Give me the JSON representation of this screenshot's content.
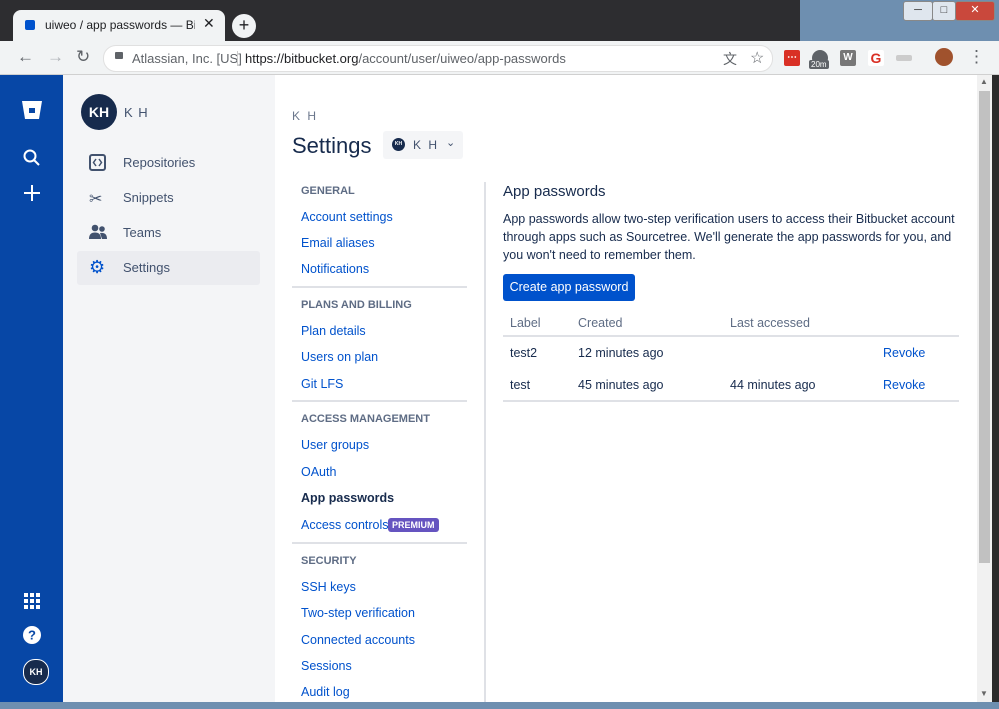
{
  "browser": {
    "tab_title": "uiweo / app passwords — Bitbuc",
    "tab_close": "✕",
    "new_tab": "+",
    "site_info": "Atlassian, Inc. [US]",
    "url_host": "https://bitbucket.org",
    "url_path": "/account/user/uiweo/app-passwords",
    "ext_badge": "20m",
    "window_min": "─",
    "window_max": "□",
    "window_close": "✕"
  },
  "global_nav": {
    "avatar": "KH"
  },
  "sidebar": {
    "avatar": "KH",
    "user_name": "K H",
    "items": [
      {
        "label": "Repositories",
        "icon": "repo-icon"
      },
      {
        "label": "Snippets",
        "icon": "scissors-icon"
      },
      {
        "label": "Teams",
        "icon": "people-icon"
      },
      {
        "label": "Settings",
        "icon": "gear-icon"
      }
    ]
  },
  "header": {
    "breadcrumb": "K H",
    "title": "Settings",
    "account_avatar": "KH",
    "account_label": "K H"
  },
  "settings_nav": {
    "general": "GENERAL",
    "account_settings": "Account settings",
    "email_aliases": "Email aliases",
    "notifications": "Notifications",
    "plans": "PLANS AND BILLING",
    "plan_details": "Plan details",
    "users_on_plan": "Users on plan",
    "git_lfs": "Git LFS",
    "access": "ACCESS MANAGEMENT",
    "user_groups": "User groups",
    "oauth": "OAuth",
    "app_passwords": "App passwords",
    "access_controls": "Access controls",
    "premium": "PREMIUM",
    "security": "SECURITY",
    "ssh_keys": "SSH keys",
    "two_step": "Two-step verification",
    "connected": "Connected accounts",
    "sessions": "Sessions",
    "audit_log": "Audit log"
  },
  "content": {
    "heading": "App passwords",
    "description": "App passwords allow two-step verification users to access their Bitbucket account through apps such as Sourcetree. We'll generate the app passwords for you, and you won't need to remember them.",
    "create_button": "Create app password",
    "columns": [
      "Label",
      "Created",
      "Last accessed"
    ],
    "rows": [
      {
        "label": "test2",
        "created": "12 minutes ago",
        "last_accessed": "",
        "action": "Revoke"
      },
      {
        "label": "test",
        "created": "45 minutes ago",
        "last_accessed": "44 minutes ago",
        "action": "Revoke"
      }
    ]
  },
  "colors": {
    "global_nav": "#0747a6",
    "primary": "#0052cc",
    "premium": "#6554c0"
  }
}
